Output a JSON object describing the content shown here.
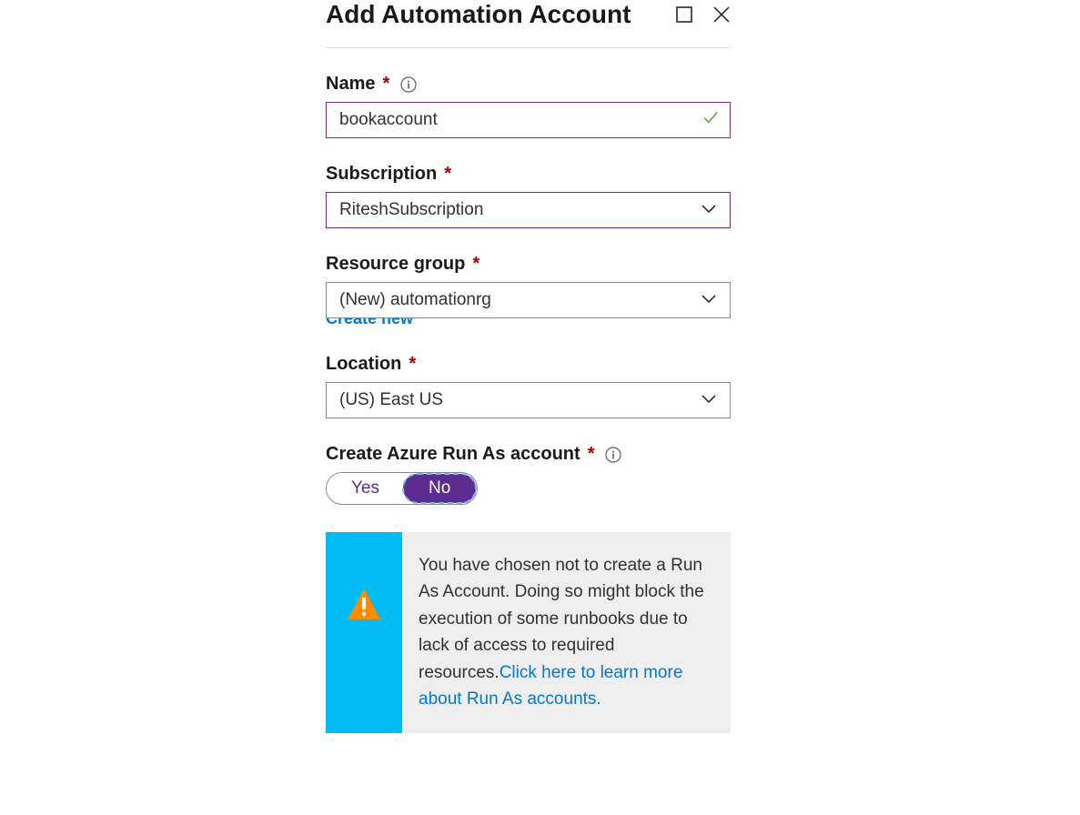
{
  "header": {
    "title": "Add Automation Account"
  },
  "fields": {
    "name": {
      "label": "Name",
      "value": "bookaccount"
    },
    "subscription": {
      "label": "Subscription",
      "value": "RiteshSubscription"
    },
    "resourceGroup": {
      "label": "Resource group",
      "value": "(New) automationrg",
      "createNew": "Create new"
    },
    "location": {
      "label": "Location",
      "value": "(US) East US"
    },
    "runAs": {
      "label": "Create Azure Run As account",
      "yes": "Yes",
      "no": "No"
    }
  },
  "info": {
    "text": "You have chosen not to create a Run As Account. Doing so might block the execution of some runbooks due to lack of access to required resources.",
    "linkText": "Click here to learn more about Run As accounts."
  }
}
